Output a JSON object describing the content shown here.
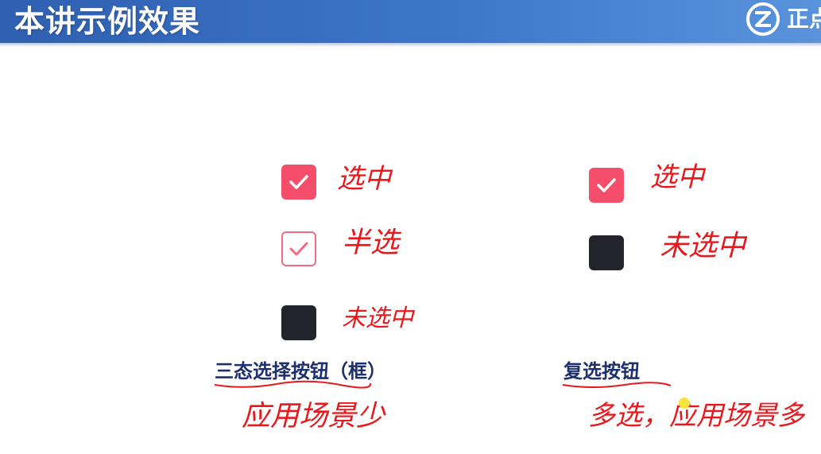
{
  "slide": {
    "title": "本讲示例效果",
    "logo_text": "正点"
  },
  "tristate": {
    "label": "三态选择按钮（框）",
    "states": [
      {
        "state": "checked",
        "note": "选中"
      },
      {
        "state": "indeterminate",
        "note": "半选"
      },
      {
        "state": "unchecked",
        "note": "未选中"
      }
    ],
    "usage_note": "应用场景少"
  },
  "multiselect": {
    "label": "复选按钮",
    "states": [
      {
        "state": "checked",
        "note": "选中"
      },
      {
        "state": "unchecked",
        "note": "未选中"
      }
    ],
    "usage_note": "多选，应用场景多"
  },
  "colors": {
    "banner": "#3d76c9",
    "checkbox_checked": "#f44e6a",
    "checkbox_unchecked": "#22232b",
    "label_text": "#1e2f6e",
    "annotation_ink": "#e8181c"
  }
}
